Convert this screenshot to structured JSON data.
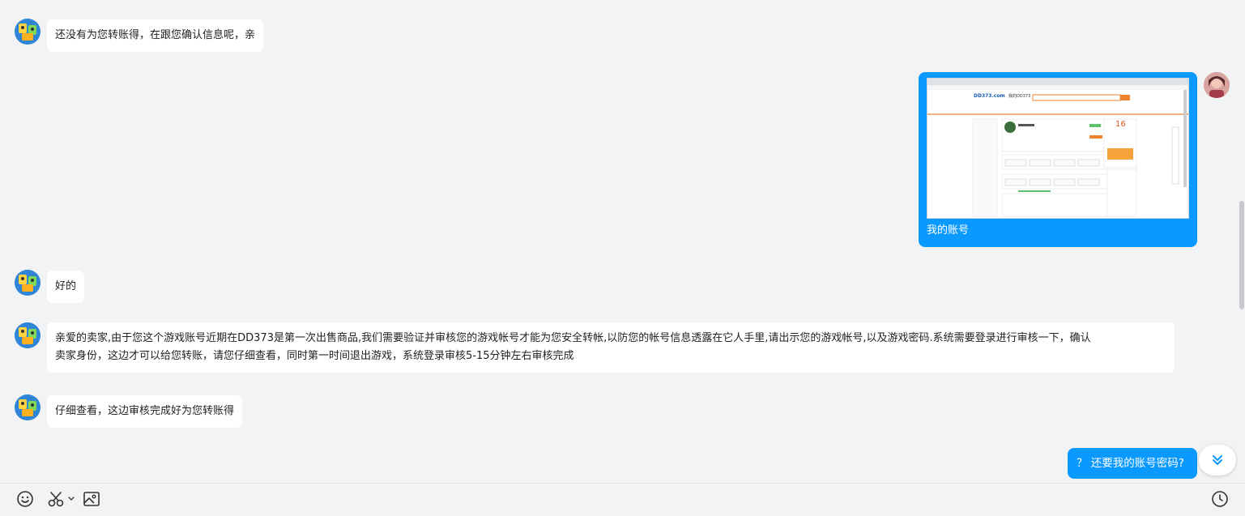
{
  "messages": {
    "m1": "还没有为您转账得，在跟您确认信息呢，亲",
    "m2_caption": "我的账号",
    "m3": "好的",
    "m4_line1": "亲爱的卖家,由于您这个游戏账号近期在DD373是第一次出售商品,我们需要验证并审核您的游戏帐号才能为您安全转帐,以防您的帐号信息透露在它人手里,请出示您的游戏帐号,以及游戏密码.系统需要登录进行审核一下，确认",
    "m4_line2": "卖家身份，这边才可以给您转账，请您仔细查看，同时第一时间退出游戏，系统登录审核5-15分钟左右审核完成",
    "m5": "仔细查看，这边审核完成好为您转账得"
  },
  "screenshot_thumb": {
    "site_logo": "DD373.com",
    "page_label": "我的DD373",
    "big_number": "16"
  },
  "quick_question": "？ 还要我的账号密码?",
  "colors": {
    "bubble_blue": "#0a99ff",
    "background": "#f2f3f5"
  },
  "icons": {
    "emoji": "smile-icon",
    "scissors": "scissors-icon",
    "image": "image-icon",
    "history": "clock-icon",
    "scroll_down": "double-chevron-down-icon"
  }
}
